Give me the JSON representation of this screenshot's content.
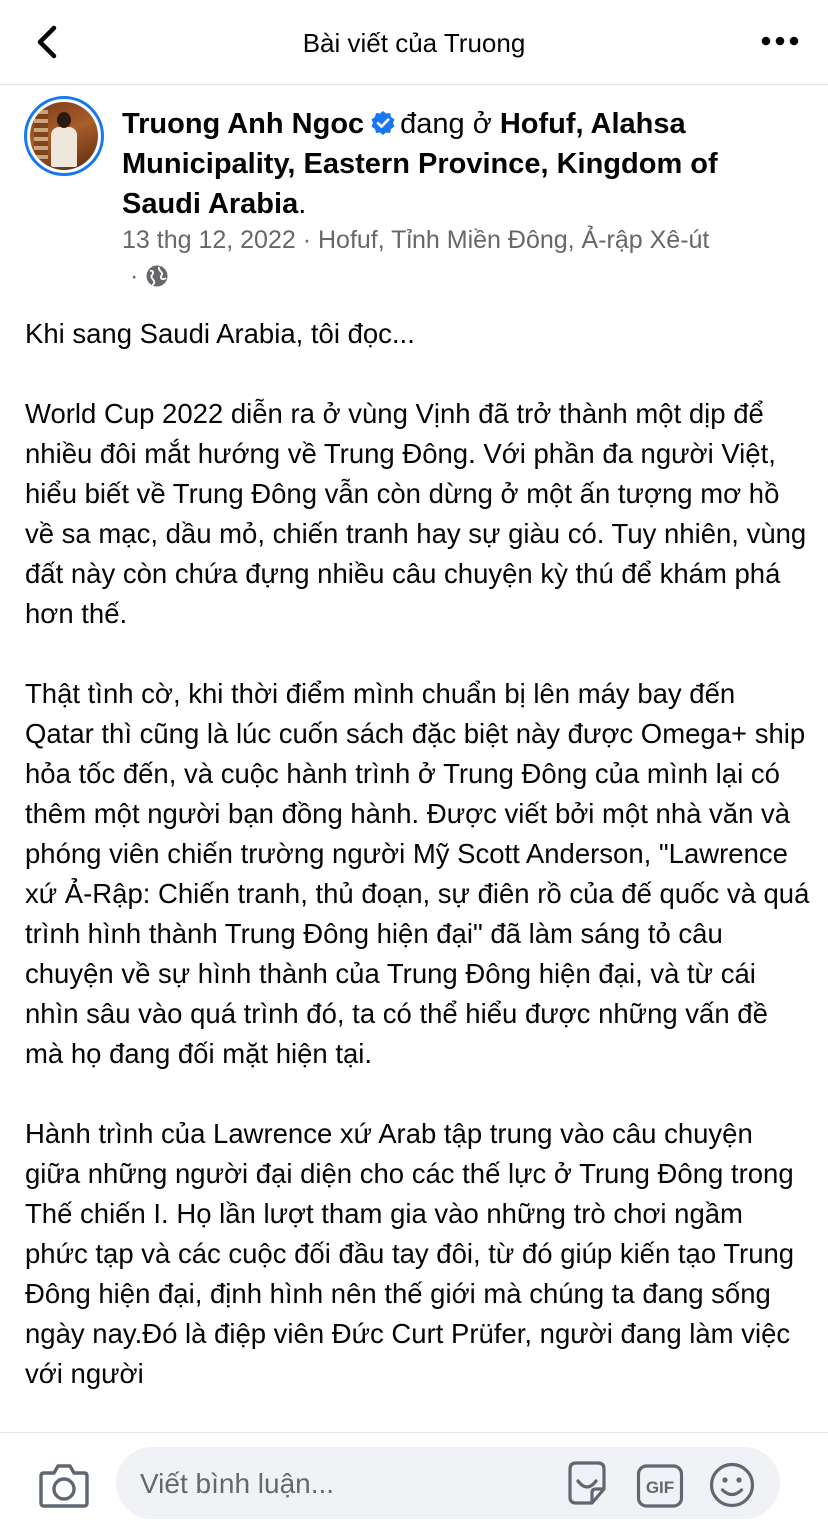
{
  "nav": {
    "title": "Bài viết của Truong"
  },
  "post": {
    "author": "Truong Anh Ngoc",
    "status_prefix": "đang ở",
    "location": "Hofuf, Alahsa Municipality, Eastern Province,  Kingdom of Saudi Arabia",
    "location_end": ".",
    "meta": "13 thg 12, 2022 · Hofuf, Tỉnh Miền Đông, Ả-rập Xê-út",
    "meta_sep": "·",
    "paragraphs": [
      "Khi sang Saudi Arabia, tôi đọc...",
      "World Cup 2022 diễn ra ở vùng Vịnh đã trở thành một dịp để nhiều đôi mắt hướng về Trung Đông. Với phần đa người Việt, hiểu biết về Trung Đông vẫn còn dừng ở một ấn tượng mơ hồ về sa mạc, dầu mỏ, chiến tranh hay sự giàu có. Tuy nhiên, vùng đất này còn chứa đựng nhiều câu chuyện kỳ thú để khám phá hơn thế.",
      "Thật tình cờ, khi thời điểm mình chuẩn bị lên máy bay đến Qatar thì cũng là lúc cuốn sách đặc biệt này được Omega+ ship hỏa tốc đến, và cuộc hành trình ở Trung Đông của mình lại có thêm một người bạn đồng hành. Được viết bởi một nhà văn và phóng viên chiến trường người Mỹ Scott Anderson, \"Lawrence xứ Ả-Rập: Chiến tranh, thủ đoạn, sự điên rồ của đế quốc và quá trình hình thành Trung Đông hiện đại\" đã làm sáng tỏ câu chuyện về sự hình thành của Trung Đông hiện đại, và từ cái nhìn sâu vào quá trình đó, ta có thể hiểu được những vấn đề mà họ đang đối mặt hiện tại.",
      "Hành trình của Lawrence xứ Arab tập trung vào câu chuyện giữa những người đại diện cho các thế lực ở Trung Đông trong Thế chiến I. Họ lần lượt tham gia vào những trò chơi ngầm phức tạp và các cuộc đối đầu tay đôi, từ đó giúp kiến tạo Trung Đông hiện đại, định hình nên thế giới mà chúng ta đang sống ngày nay.Đó là điệp viên Đức Curt Prüfer, người đang làm việc với người"
    ]
  },
  "comment": {
    "placeholder": "Viết bình luận..."
  },
  "icons": {
    "back": "chevron-left-icon",
    "more": "more-horizontal-icon",
    "verified": "verified-badge-icon",
    "globe": "globe-icon",
    "camera": "camera-icon",
    "sticker": "sticker-icon",
    "gif": "gif-icon",
    "emoji": "emoji-icon"
  },
  "colors": {
    "accent": "#1877f2",
    "muted_text": "#65676b",
    "comment_bg": "#f0f2f5"
  }
}
